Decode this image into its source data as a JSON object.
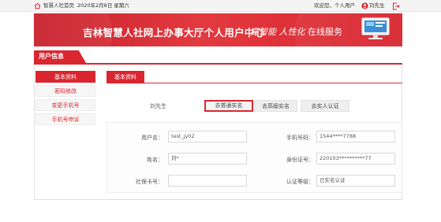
{
  "topbar": {
    "home_link": "智慧人社首页",
    "date": "2020年2月8日 星期六",
    "greeting": "欢迎您，个人用户",
    "user_name": "刘先生"
  },
  "banner": {
    "title": "吉林智慧人社网上办事大厅个人用户中心",
    "slogan_main": "高智能 人性化",
    "slogan_tail": " 在线服务"
  },
  "section": {
    "title": "用户信息"
  },
  "sidebar": {
    "items": [
      {
        "label": "基本资料"
      },
      {
        "label": "密码修改"
      },
      {
        "label": "变更手机号"
      },
      {
        "label": "手机号申诉"
      }
    ]
  },
  "content": {
    "tab": "基本资料",
    "display_name": "刘先生",
    "realname_buttons": [
      {
        "label": "去普通实名"
      },
      {
        "label": "去高级实名"
      },
      {
        "label": "去实人认证"
      }
    ]
  },
  "form": {
    "username_label": "用户名：",
    "username_value": "test_jy02",
    "phone_label": "手机号码：",
    "phone_value": "1544****7788",
    "name_label": "姓名：",
    "name_value": "刘*",
    "idcard_label": "身份证号：",
    "idcard_value": "220103**********77",
    "social_label": "社保卡号：",
    "social_value": "",
    "level_label": "认证等级：",
    "level_value": "已实名认证"
  },
  "colors": {
    "accent": "#d9262f",
    "banner": "#e23a3f"
  }
}
